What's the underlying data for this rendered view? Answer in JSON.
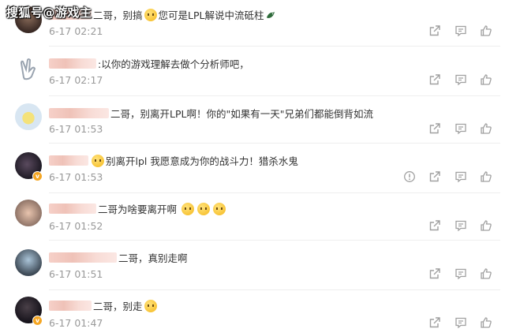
{
  "watermark": "搜狐号@游戏主",
  "colors": {
    "time": "#999999",
    "text": "#333333",
    "icon": "#a0a0a0",
    "verified_badge": "#f5a623"
  },
  "icons": {
    "share": "share-icon",
    "comment": "comment-icon",
    "like": "thumbs-up-icon",
    "report": "report-icon"
  },
  "comments": [
    {
      "text": "二哥，别搞",
      "text2": "您可是LPL解说中流砥柱",
      "time": "6-17 02:21"
    },
    {
      "text": ":以你的游戏理解去做个分析师吧，",
      "time": "6-17 02:17"
    },
    {
      "text": "二哥，别离开LPL啊！你的\"如果有一天\"兄弟们都能倒背如流",
      "time": "6-17 01:53"
    },
    {
      "text": "别离开lpl 我愿意成为你的战斗力！猎杀水鬼",
      "time": "6-17 01:53"
    },
    {
      "text": "二哥为啥要离开啊",
      "time": "6-17 01:52"
    },
    {
      "text": "二哥，真别走啊",
      "time": "6-17 01:51"
    },
    {
      "text": "二哥，别走",
      "time": "6-17 01:47"
    }
  ]
}
